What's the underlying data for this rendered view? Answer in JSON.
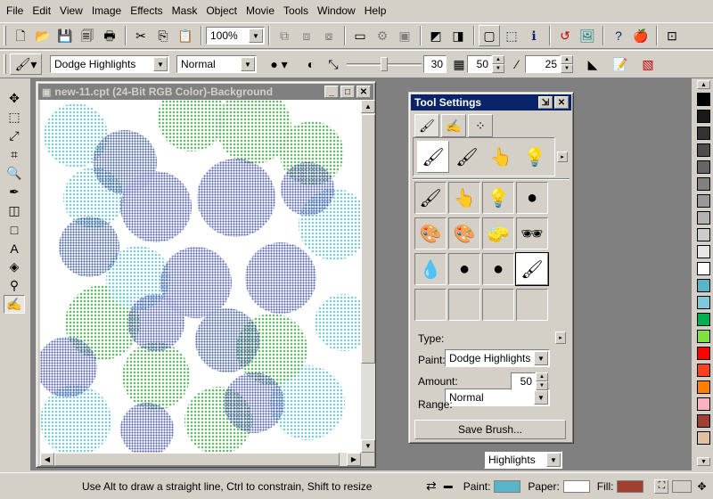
{
  "menu": [
    "File",
    "Edit",
    "View",
    "Image",
    "Effects",
    "Mask",
    "Object",
    "Movie",
    "Tools",
    "Window",
    "Help"
  ],
  "toolbar1": {
    "zoom": "100%",
    "icons": [
      "new-icon",
      "open-icon",
      "save-icon",
      "save-as-icon",
      "print-icon",
      "cut-icon",
      "copy-icon",
      "paste-icon"
    ]
  },
  "toolbar2": {
    "brush_type": "Dodge Highlights",
    "paint_mode": "Normal",
    "size": "30",
    "amount": "50",
    "transparency": "25"
  },
  "document": {
    "title": "new-11.cpt  (24-Bit RGB Color)-Background"
  },
  "tool_settings": {
    "title": "Tool Settings",
    "type_label": "Type:",
    "type_value": "Dodge Highlights",
    "paint_label": "Paint:",
    "paint_value": "Normal",
    "amount_label": "Amount:",
    "amount_value": "50",
    "range_label": "Range:",
    "range_value": "Highlights",
    "save_brush": "Save Brush..."
  },
  "palette_colors": [
    "#000000",
    "#1a1a1a",
    "#333333",
    "#4d4d4d",
    "#666666",
    "#808080",
    "#999999",
    "#b3b3b3",
    "#cccccc",
    "#e6e6e6",
    "#ffffff",
    "#5ab4c8",
    "#80c8e0",
    "#00b050",
    "#80e040",
    "#ff0000",
    "#ff4020",
    "#ff8000",
    "#ffb0c0",
    "#a04030",
    "#e0c0a0"
  ],
  "status": {
    "message": "Use Alt to draw a straight line, Ctrl to constrain, Shift to resize",
    "paint_label": "Paint:",
    "paper_label": "Paper:",
    "fill_label": "Fill:",
    "paint_color": "#5ab4c8",
    "paper_color": "#ffffff",
    "fill_color": "#a04030"
  }
}
